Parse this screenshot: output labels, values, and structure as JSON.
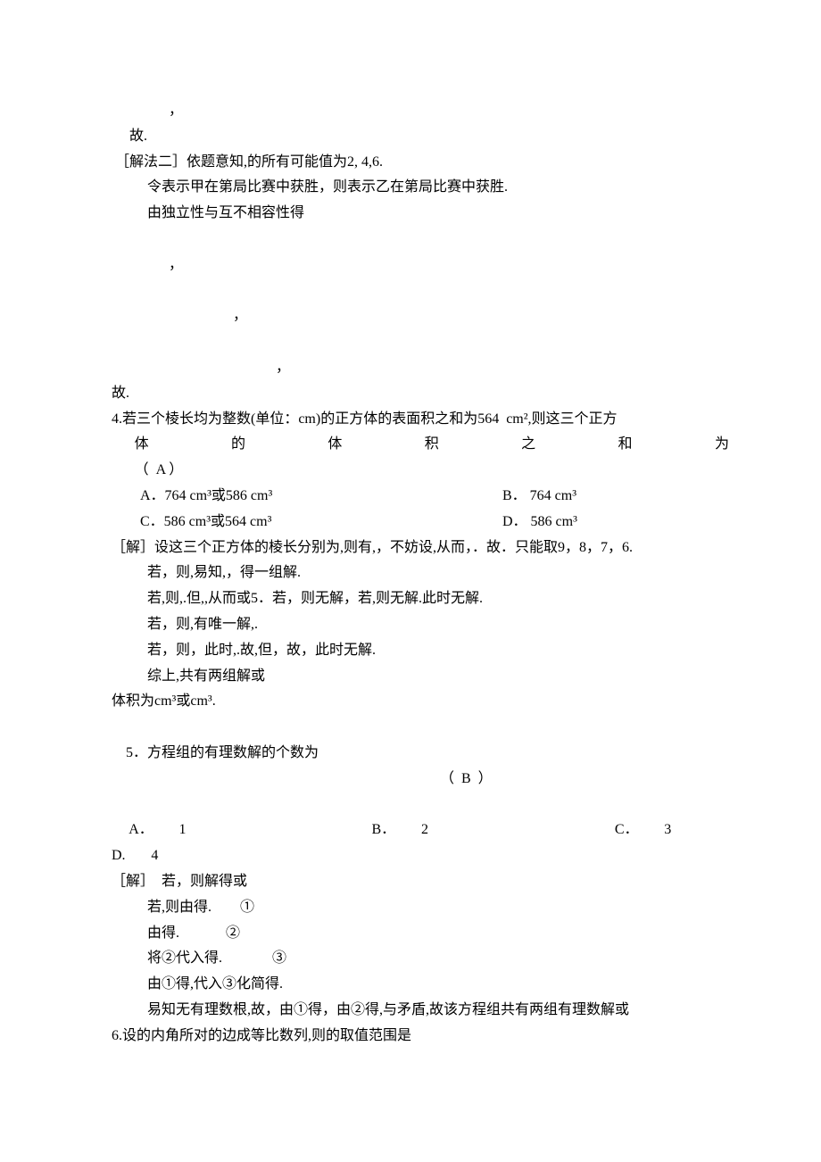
{
  "page": {
    "commas": {
      "c1": "，",
      "c2": "，",
      "c3": "，",
      "c4": "，",
      "c5": "，"
    },
    "l01": "     故.",
    "l02": " ［解法二］依题意知,的所有可能值为2, 4,6.",
    "l03": "令表示甲在第局比赛中获胜，则表示乙在第局比赛中获胜.",
    "l04": "由独立性与互不相容性得",
    "l05": "故.",
    "q4": {
      "line1": "4.若三个棱长均为整数(单位：cm)的正方体的表面积之和为564  cm²,则这三个正方",
      "line2_chars": [
        "体",
        "的",
        "体",
        "积",
        "之",
        "和",
        "为"
      ],
      "line3": "（  A ）",
      "optA": "A．764 cm³或586 cm³",
      "optB": "B． 764 cm³",
      "optC": "C．586 cm³或564 cm³",
      "optD": "D． 586 cm³"
    },
    "s4": {
      "l1": "［解］设这三个正方体的棱长分别为,则有,，不妨设,从而，．故．只能取9，8，7，6.",
      "l2": "若，则,易知,，得一组解.",
      "l3": "若,则,.但,,从而或5．若，则无解，若,则无解.此时无解.",
      "l4": "若，则,有唯一解,.",
      "l5": "若，则，此时,.故,但，故，此时无解.",
      "l6": "综上,共有两组解或",
      "l7": "体积为cm³或cm³."
    },
    "q5": {
      "line1": "5．方程组的有理数解的个数为",
      "ans": "（  B  ）",
      "A": "A．",
      "A2": "1",
      "B": "B．",
      "B2": "2",
      "C": "C．",
      "C2": "3",
      "D": "D.",
      "D2": "4"
    },
    "s5": {
      "l1": "［解］  若，则解得或",
      "l2": "若,则由得.        ①",
      "l3": "由得.             ②",
      "l4": "将②代入得.              ③",
      "l5": "由①得,代入③化简得.",
      "l6": "易知无有理数根,故，由①得，由②得,与矛盾,故该方程组共有两组有理数解或"
    },
    "q6": "6.设的内角所对的边成等比数列,则的取值范围是"
  }
}
